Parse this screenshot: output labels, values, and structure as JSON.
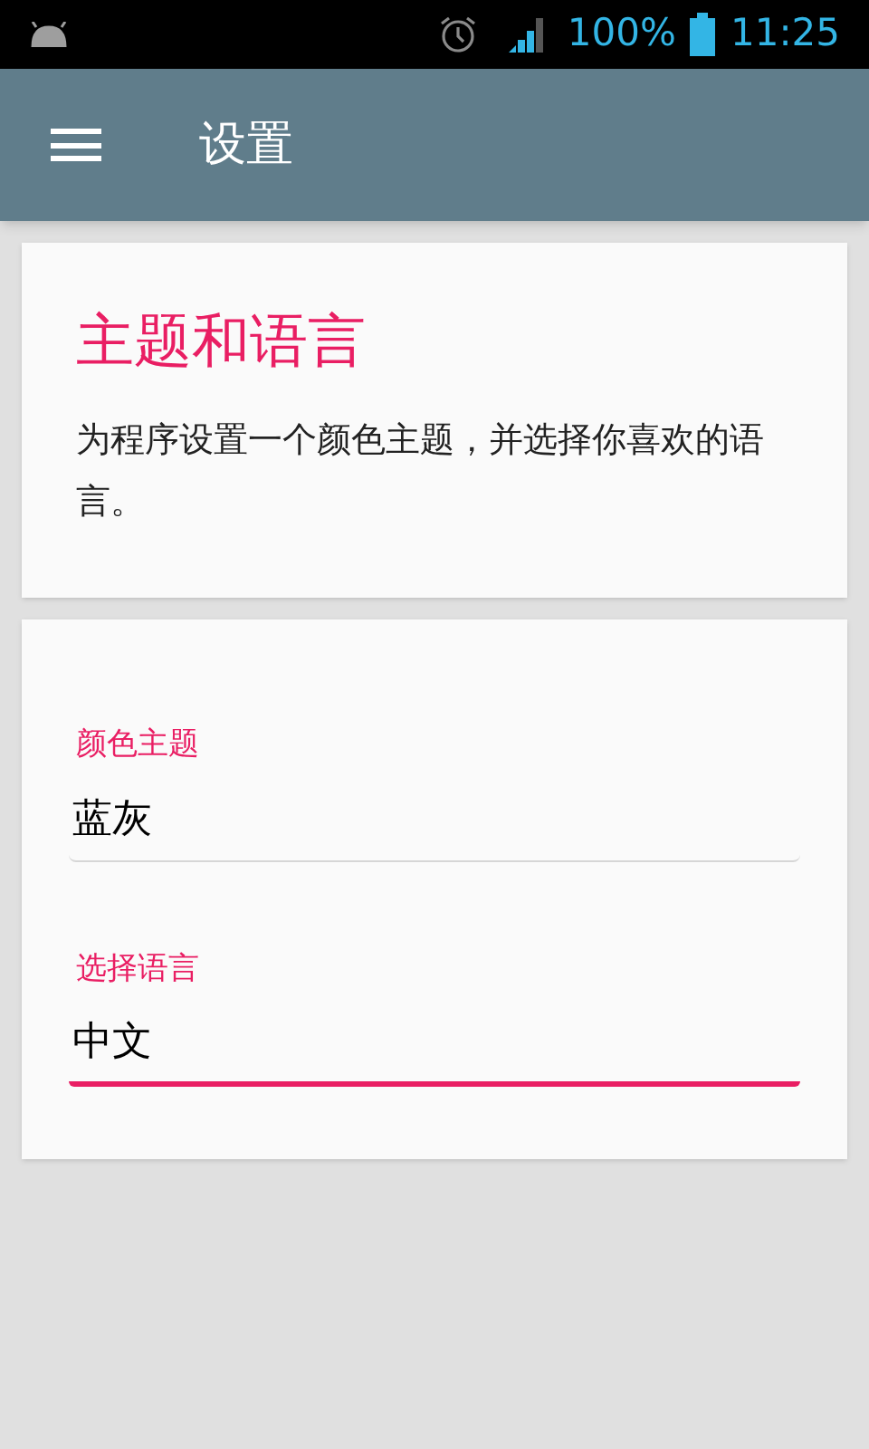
{
  "status_bar": {
    "battery": "100%",
    "time": "11:25"
  },
  "app_bar": {
    "title": "设置"
  },
  "intro_card": {
    "title": "主题和语言",
    "description": "为程序设置一个颜色主题，并选择你喜欢的语言。"
  },
  "fields": [
    {
      "label": "颜色主题",
      "value": "蓝灰",
      "focused": false
    },
    {
      "label": "选择语言",
      "value": "中文",
      "focused": true
    }
  ]
}
